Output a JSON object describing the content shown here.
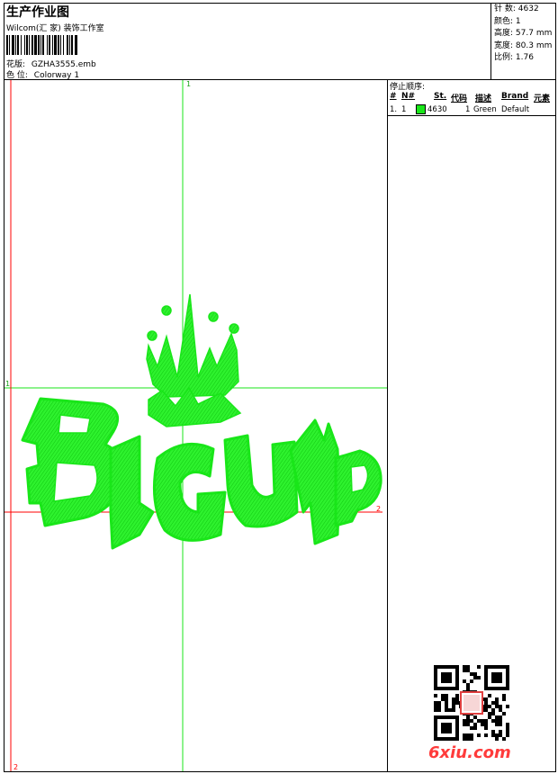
{
  "header": {
    "title": "生产作业图",
    "software": "Wilcom(汇 家) 装饰工作室",
    "design_label": "花版:",
    "design_value": "GZHA3555.emb",
    "colorway_label": "色 位:",
    "colorway_value": "Colorway 1"
  },
  "stats": {
    "stitches_label": "针 数:",
    "stitches_value": "4632",
    "colors_label": "颜色:",
    "colors_value": "1",
    "height_label": "高度:",
    "height_value": "57.7 mm",
    "width_label": "宽度:",
    "width_value": "80.3 mm",
    "ratio_label": "比例:",
    "ratio_value": "1.76"
  },
  "design": {
    "text": "BIGUMP",
    "thread_color": "#19e619",
    "guide_color": "#19e619",
    "axis_color": "#ff0000",
    "markers": {
      "top": "1",
      "left": "1",
      "right": "2",
      "bottom": "2"
    }
  },
  "stop_sequence": {
    "title": "停止顺序:",
    "columns": [
      "#",
      "N#",
      "St.",
      "代码",
      "描述",
      "Brand",
      "元素"
    ],
    "rows": [
      {
        "index": "1.",
        "needle": "1",
        "swatch_color": "#19e619",
        "stitches": "4630",
        "code": "1",
        "description": "Green",
        "brand": "Default"
      }
    ]
  },
  "watermark": {
    "text": "6xiu.com",
    "color": "#ff3b3b"
  }
}
